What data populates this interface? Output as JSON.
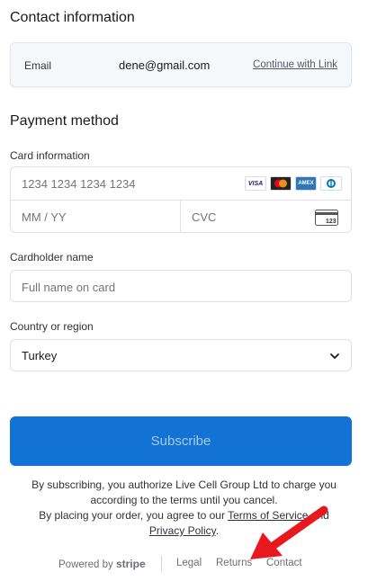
{
  "contact": {
    "title": "Contact information",
    "email_label": "Email",
    "email_value": "dene@gmail.com",
    "continue_link": "Continue with Link"
  },
  "payment": {
    "title": "Payment method",
    "card_label": "Card information",
    "card_number_placeholder": "1234 1234 1234 1234",
    "expiry_placeholder": "MM / YY",
    "cvc_placeholder": "CVC",
    "brands": [
      "VISA",
      "mastercard",
      "AMEX",
      "diners"
    ],
    "cvc_icon_text": "123",
    "name_label": "Cardholder name",
    "name_placeholder": "Full name on card",
    "country_label": "Country or region",
    "country_value": "Turkey"
  },
  "subscribe_label": "Subscribe",
  "legal": {
    "line1": "By subscribing, you authorize Live Cell Group Ltd to charge you",
    "line2": "according to the terms until you cancel.",
    "line3_prefix": "By placing your order, you agree to our ",
    "terms_link": "Terms of Service",
    "and": " and",
    "privacy_link": "Privacy Policy",
    "period": "."
  },
  "footer": {
    "powered_by": "Powered by",
    "stripe": "stripe",
    "legal": "Legal",
    "returns": "Returns",
    "contact": "Contact"
  },
  "colors": {
    "accent": "#1273d4",
    "annotation_arrow": "#e8191e"
  }
}
